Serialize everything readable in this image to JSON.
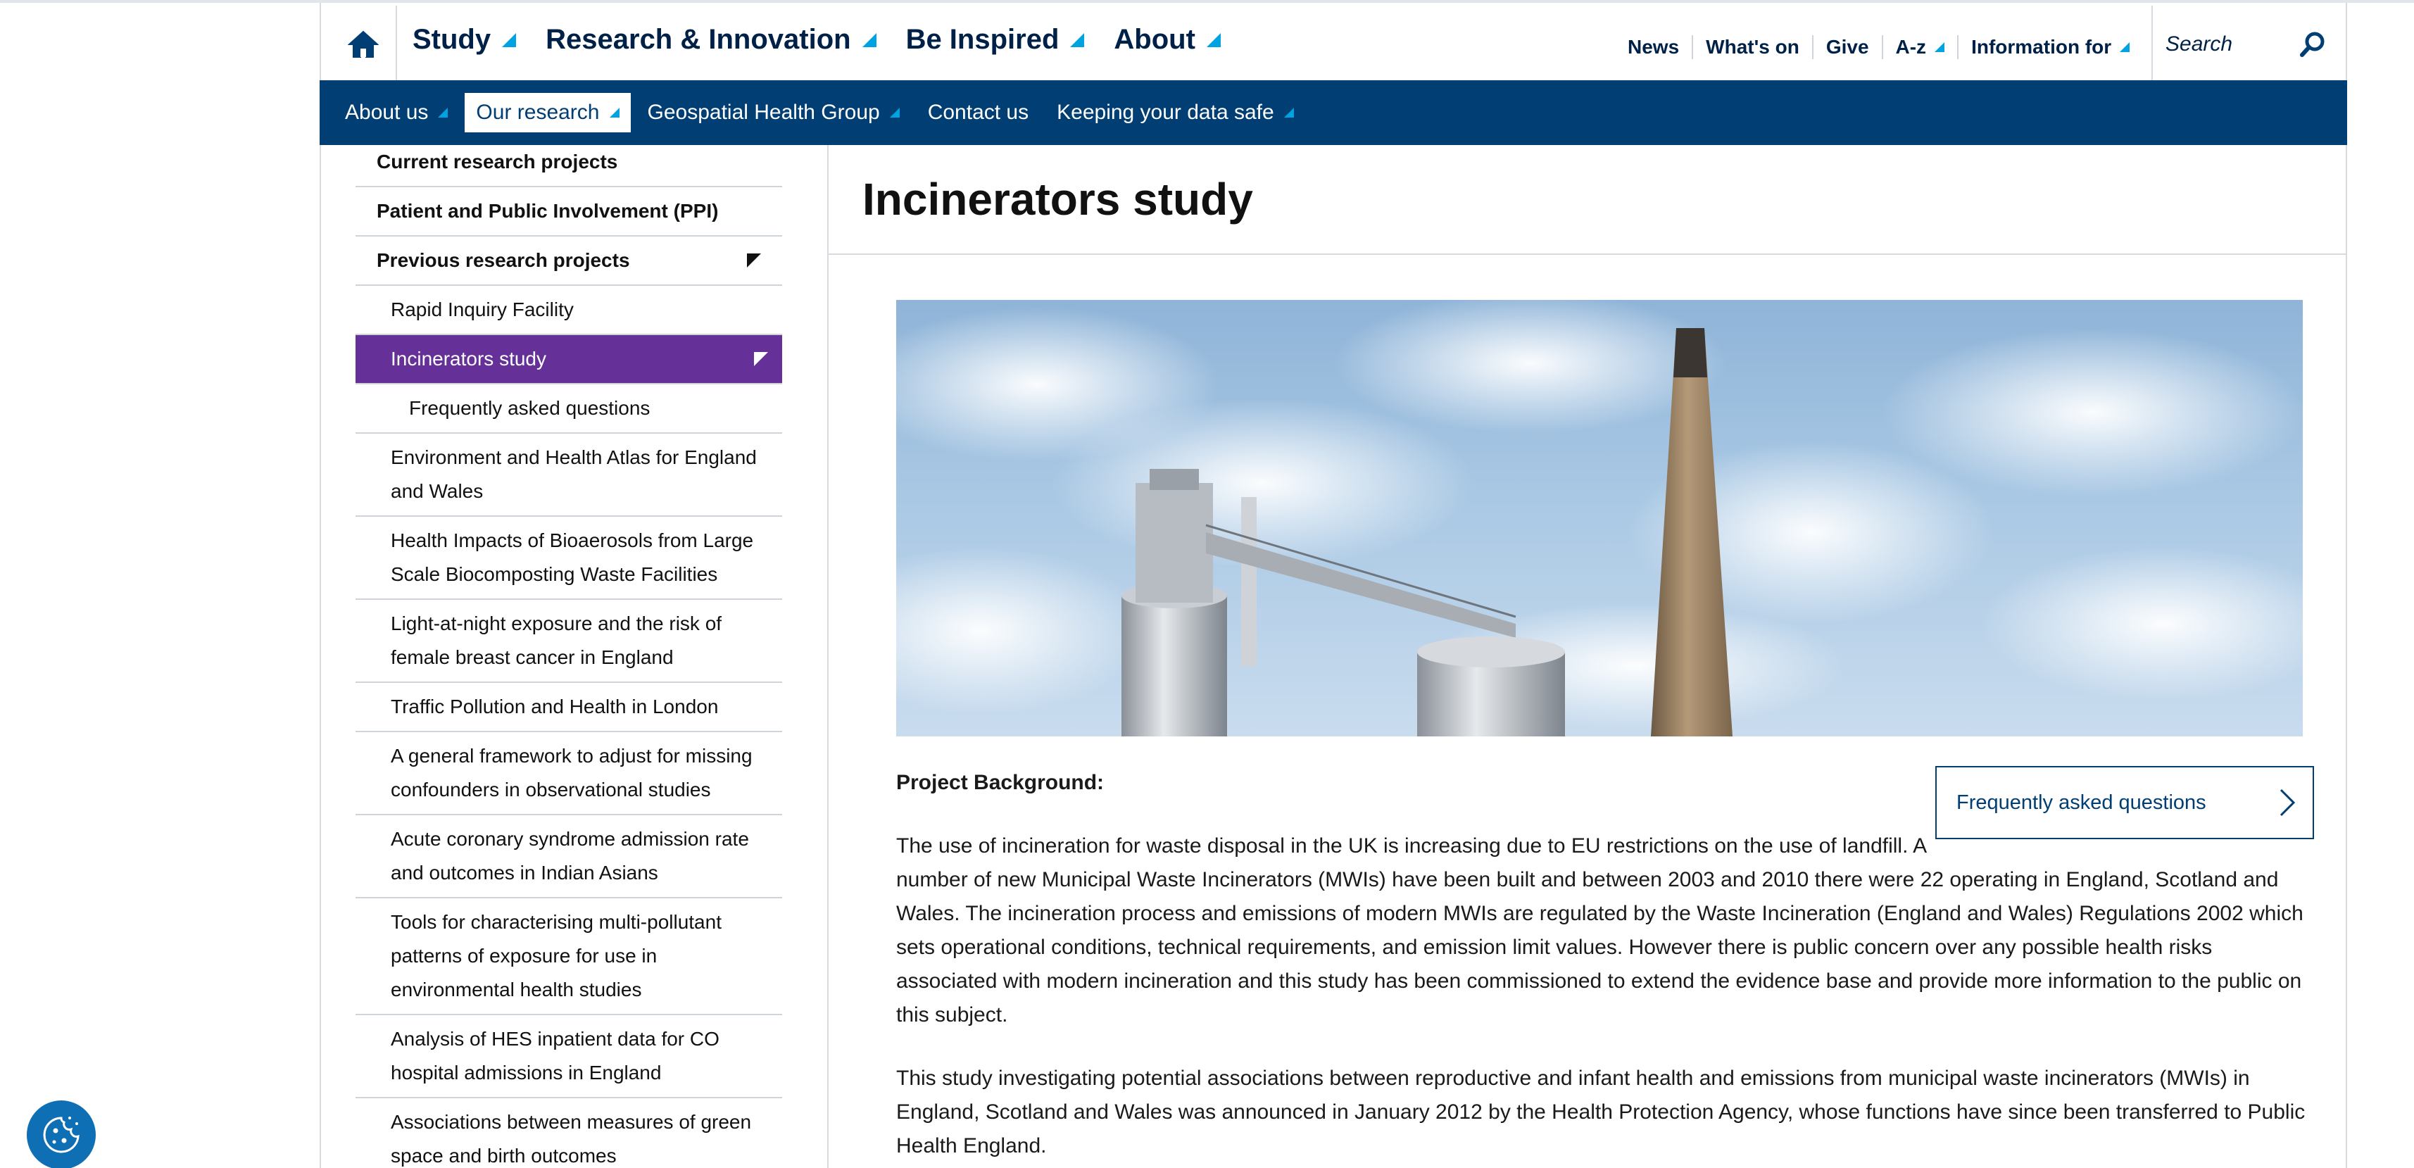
{
  "header": {
    "main_nav": [
      {
        "label": "Study"
      },
      {
        "label": "Research & Innovation"
      },
      {
        "label": "Be Inspired"
      },
      {
        "label": "About"
      }
    ],
    "utility_nav": [
      {
        "label": "News"
      },
      {
        "label": "What's on"
      },
      {
        "label": "Give"
      },
      {
        "label": "A-z"
      },
      {
        "label": "Information for"
      }
    ],
    "search_placeholder": "Search"
  },
  "subnav": [
    {
      "label": "About us"
    },
    {
      "label": "Our research"
    },
    {
      "label": "Geospatial Health Group"
    },
    {
      "label": "Contact us"
    },
    {
      "label": "Keeping your data safe"
    }
  ],
  "sidebar": {
    "items": [
      {
        "label": "Current research projects"
      },
      {
        "label": "Patient and Public Involvement (PPI)"
      },
      {
        "label": "Previous research projects"
      },
      {
        "label": "Rapid Inquiry Facility"
      },
      {
        "label": "Incinerators study"
      },
      {
        "label": "Frequently asked questions"
      },
      {
        "label": "Environment and Health Atlas for England and Wales"
      },
      {
        "label": "Health Impacts of Bioaerosols from Large Scale Biocomposting Waste Facilities"
      },
      {
        "label": "Light-at-night exposure and the risk of female breast cancer in England"
      },
      {
        "label": "Traffic Pollution and Health in London"
      },
      {
        "label": "A general framework to adjust for missing confounders in observational studies"
      },
      {
        "label": "Acute coronary syndrome admission rate and outcomes in Indian Asians"
      },
      {
        "label": "Tools for characterising multi-pollutant patterns of exposure for use in environmental health studies"
      },
      {
        "label": "Analysis of HES inpatient data for CO hospital admissions in England"
      },
      {
        "label": "Associations between measures of green space and birth outcomes"
      }
    ]
  },
  "main": {
    "title": "Incinerators study",
    "faq_button": "Frequently asked questions",
    "section_heading": "Project Background:",
    "paragraphs": [
      "The use of incineration for waste disposal in the UK is increasing due to EU restrictions on the use of landfill. A number of new Municipal Waste Incinerators (MWIs) have been built and between 2003 and 2010 there were 22 operating in England, Scotland and Wales. The incineration process and emissions of modern MWIs are regulated by the Waste Incineration (England and Wales) Regulations 2002 which sets operational conditions, technical requirements, and emission limit values. However there is public concern over any possible health risks associated with modern incineration and this study has been commissioned to extend the evidence base and provide more information to the public on this subject.",
      "This study investigating potential associations between reproductive and infant health and emissions from municipal waste incinerators (MWIs) in England, Scotland and Wales was announced in January 2012 by the Health Protection Agency, whose functions have since been transferred to Public Health England."
    ]
  },
  "colors": {
    "navy": "#003e74",
    "brand_dark": "#002147",
    "accent_cyan": "#00a3e0",
    "active_purple": "#653098"
  }
}
